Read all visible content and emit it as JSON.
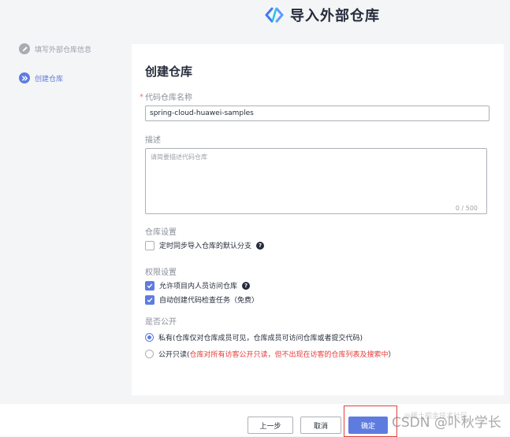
{
  "header": {
    "title": "导入外部仓库"
  },
  "steps": [
    {
      "label": "填写外部仓库信息"
    },
    {
      "label": "创建仓库"
    }
  ],
  "form": {
    "title": "创建仓库",
    "required_mark": "*",
    "repo_name": {
      "label": "代码仓库名称",
      "value": "spring-cloud-huawei-samples"
    },
    "description": {
      "label": "描述",
      "placeholder": "请简要描述代码仓库",
      "counter": "0 / 500"
    },
    "repo_settings": {
      "label": "仓库设置",
      "sync_default_branch": {
        "label": "定时同步导入仓库的默认分支",
        "checked": false
      }
    },
    "permission": {
      "label": "权限设置",
      "allow_members": {
        "label": "允许项目内人员访问仓库",
        "checked": true
      },
      "auto_check": {
        "label": "自动创建代码检查任务（免费）",
        "checked": true
      }
    },
    "visibility": {
      "label": "是否公开",
      "private": {
        "label": "私有(仓库仅对仓库成员可见，仓库成员可访问仓库或者提交代码)",
        "selected": true
      },
      "public_readonly": {
        "label_prefix": "公开只读(",
        "label_red": "仓库对所有访客公开只读，但不出现在访客的仓库列表及搜索中",
        "label_suffix": "）",
        "selected": false
      }
    }
  },
  "footer": {
    "prev_label": "上一步",
    "cancel_label": "取消",
    "ok_label": "确定"
  },
  "watermark": {
    "main": "CSDN @卟秋学长",
    "faint": "@稀土掘金技术社区"
  },
  "colors": {
    "accent": "#5e7ce0",
    "required": "#f66f6a",
    "warning_text": "#e53935",
    "highlight_box": "#e0403a"
  },
  "icons": {
    "logo": "codehub-logo-icon",
    "step1": "pencil-icon",
    "step2": "double-chevron-right-icon",
    "help": "question-mark-icon",
    "check": "check-icon"
  }
}
